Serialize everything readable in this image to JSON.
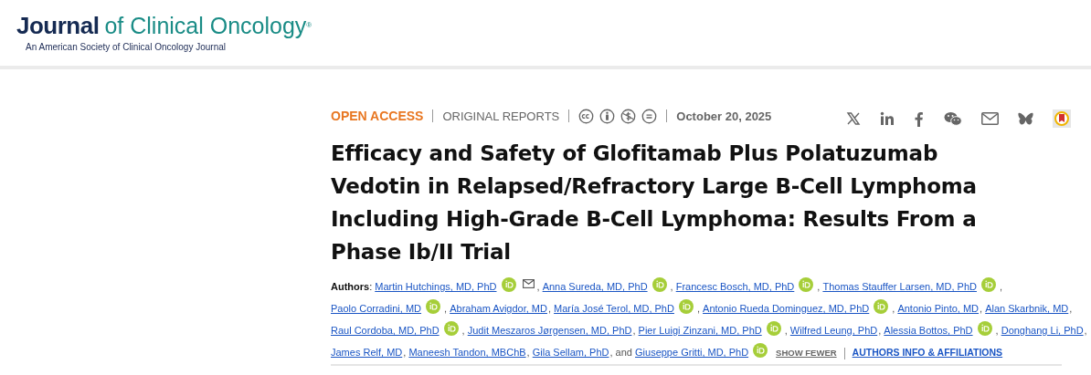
{
  "header": {
    "logo": {
      "primary": "Journal",
      "secondary": "of Clinical Oncology",
      "mark": "®",
      "tagline": "An American Society of Clinical Oncology Journal"
    }
  },
  "article": {
    "access": "OPEN ACCESS",
    "type": "ORIGINAL REPORTS",
    "date": "October 20, 2025",
    "title": "Efficacy and Safety of Glofitamab Plus Polatuzumab Vedotin in Relapsed/Refractory Large B-Cell Lymphoma Including High-Grade B-Cell Lymphoma: Results From a Phase Ib/II Trial",
    "authors_label": "**Authors**:",
    "authors": [
      {
        "name": "Martin Hutchings, MD, PhD",
        "orcid": true,
        "email": true
      },
      {
        "sep": ", ",
        "name": "Anna Sureda, MD, PhD",
        "orcid": true,
        "email": false
      },
      {
        "sep": ", ",
        "name": "Francesc Bosch, MD, PhD",
        "orcid": true,
        "email": false
      },
      {
        "sep": ", ",
        "name": "Thomas Stauffer Larsen, MD, PhD",
        "orcid": true,
        "email": false
      },
      {
        "sep": ", ",
        "name": "Paolo Corradini, MD",
        "orcid": true,
        "email": false
      },
      {
        "sep": ", ",
        "name": "Abraham Avigdor, MD",
        "orcid": false,
        "email": false
      },
      {
        "sep": ", ",
        "name": "María José Terol, MD, PhD",
        "orcid": true,
        "email": false
      },
      {
        "sep": ", ",
        "name": "Antonio Rueda Dominguez, MD, PhD",
        "orcid": true,
        "email": false
      },
      {
        "sep": ", ",
        "name": "Antonio Pinto, MD",
        "orcid": false,
        "email": false
      },
      {
        "sep": ", ",
        "name": "Alan Skarbnik, MD",
        "orcid": false,
        "email": false
      },
      {
        "sep": ", ",
        "name": "Raul Cordoba, MD, PhD",
        "orcid": true,
        "email": false
      },
      {
        "sep": ", ",
        "name": "Judit Meszaros Jørgensen, MD, PhD",
        "orcid": false,
        "email": false
      },
      {
        "sep": ", ",
        "name": "Pier Luigi Zinzani, MD, PhD",
        "orcid": true,
        "email": false
      },
      {
        "sep": ", ",
        "name": "Wilfred Leung, PhD",
        "orcid": false,
        "email": false
      },
      {
        "sep": ", ",
        "name": "Alessia Bottos, PhD",
        "orcid": true,
        "email": false
      },
      {
        "sep": ", ",
        "name": "Donghang Li, PhD",
        "orcid": false,
        "email": false
      },
      {
        "sep": ", ",
        "name": "James Relf, MD",
        "orcid": false,
        "email": false
      },
      {
        "sep": ", ",
        "name": "Maneesh Tandon, MBChB",
        "orcid": false,
        "email": false
      },
      {
        "sep": ", ",
        "name": "Gila Sellam, PhD",
        "orcid": false,
        "email": false
      },
      {
        "sep": ", and ",
        "name": "Giuseppe Gritti, MD, PhD",
        "orcid": true,
        "email": false
      }
    ],
    "show_fewer": "SHOW FEWER",
    "affiliations": "AUTHORS INFO & AFFILIATIONS"
  }
}
